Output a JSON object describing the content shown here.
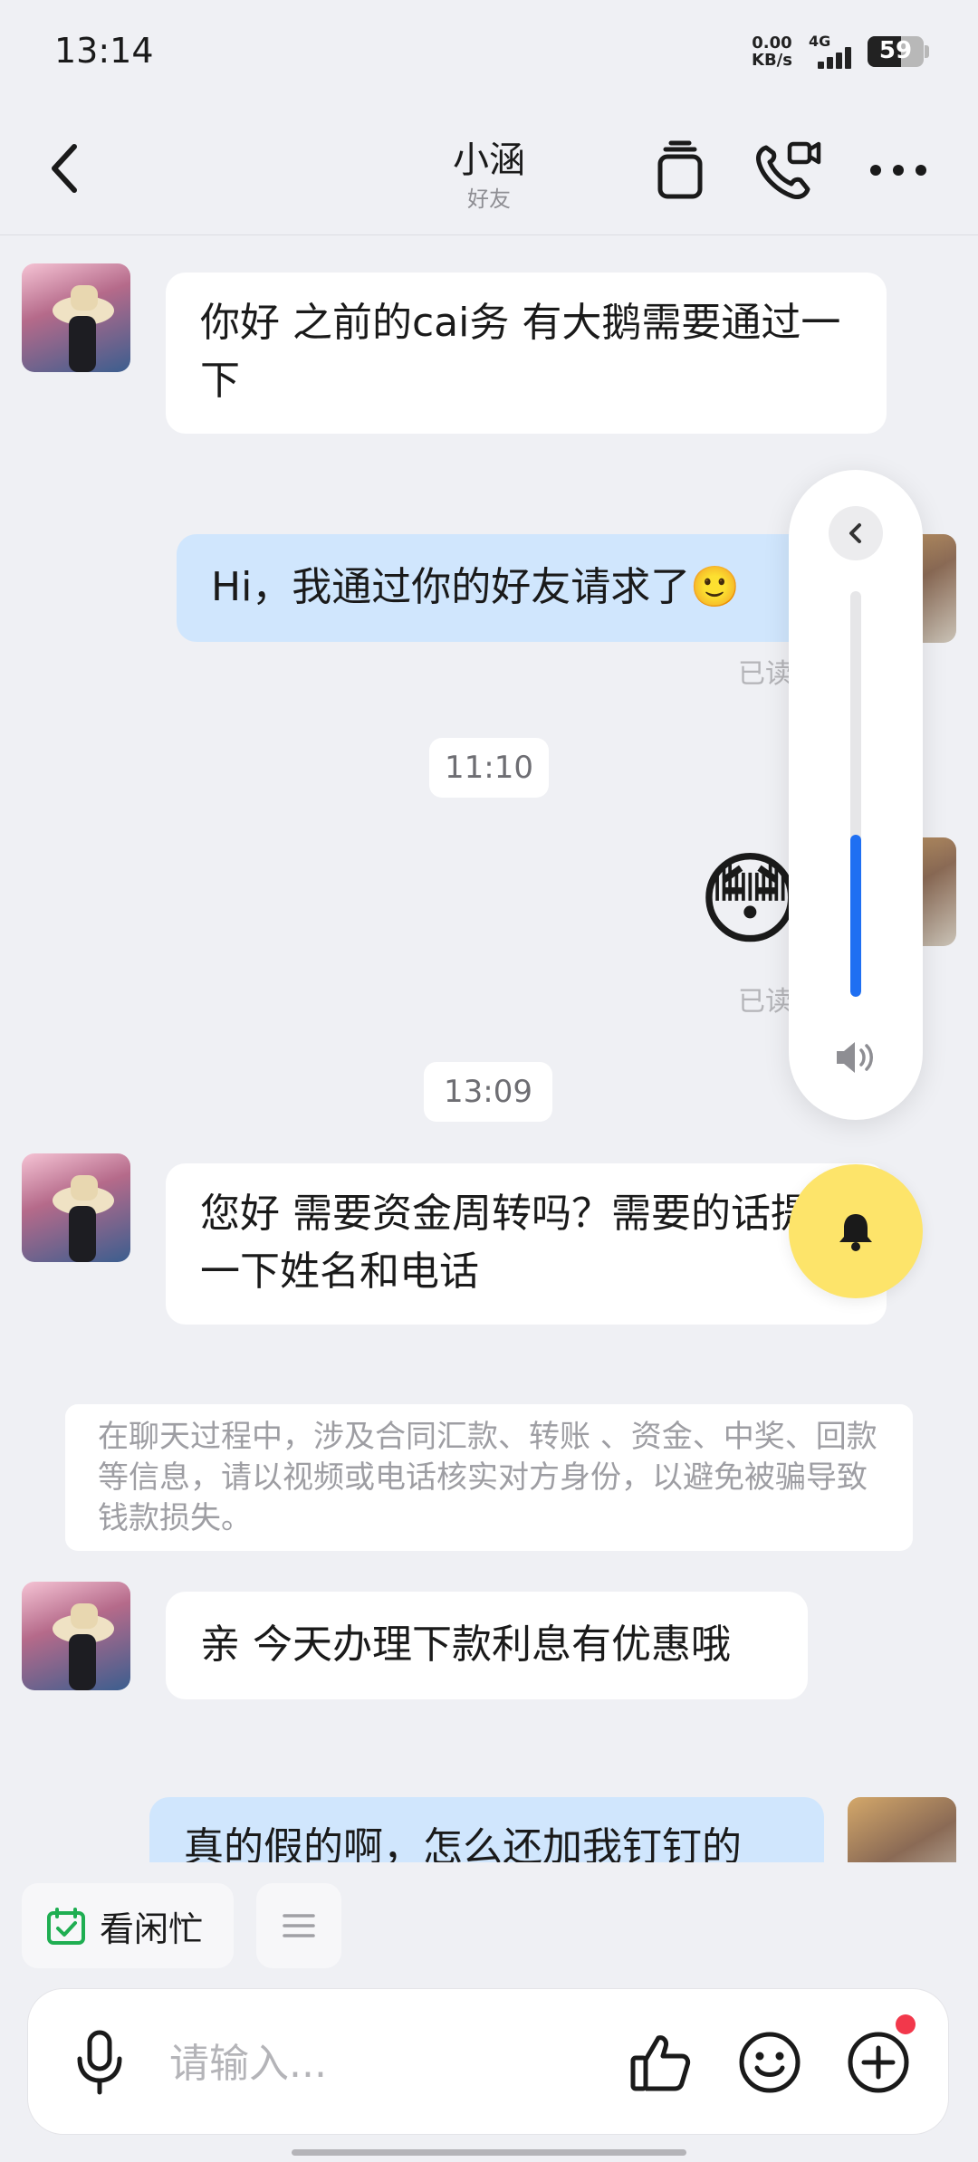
{
  "status_bar": {
    "time": "13:14",
    "net_speed_value": "0.00",
    "net_speed_unit": "KB/s",
    "network": "4G",
    "battery": "59",
    "battery_level": 0.59
  },
  "header": {
    "title": "小涵",
    "subtitle": "好友",
    "icons": [
      "back-icon",
      "copy-icon",
      "call-video-icon",
      "more-icon"
    ]
  },
  "messages": [
    {
      "side": "in",
      "text": "你好 之前的cai务 有大鹅需要通过一下"
    },
    {
      "side": "out",
      "text": "Hi，我通过你的好友请求了🙂",
      "status": "已读"
    },
    {
      "side": "time",
      "text": "11:10"
    },
    {
      "side": "out",
      "emoji": "😳",
      "status": "已读"
    },
    {
      "side": "time",
      "text": "13:09"
    },
    {
      "side": "in",
      "text": "您好 需要资金周转吗？需要的话提供一下姓名和电话"
    },
    {
      "side": "notice",
      "text": "在聊天过程中，涉及合同汇款、转账 、资金、中奖、回款等信息，请以视频或电话核实对方身份，以避免被骗导致钱款损失。"
    },
    {
      "side": "in",
      "text": "亲 今天办理下款利息有优惠哦"
    },
    {
      "side": "out",
      "text": "真的假的啊，怎么还加我钉钉的"
    }
  ],
  "volume_panel": {
    "level": 0.4,
    "icons": [
      "collapse-icon",
      "speaker-icon"
    ],
    "accent": "#1f6ff2"
  },
  "bell_button": {
    "icon": "bell-icon",
    "color": "#fde46a"
  },
  "quick_actions": [
    {
      "label": "看闲忙",
      "icon": "calendar-check-icon"
    },
    {
      "label": "",
      "icon": "menu-icon"
    }
  ],
  "input": {
    "placeholder": "请输入...",
    "value": "",
    "icons": [
      "mic-icon",
      "thumbs-up-icon",
      "smile-icon",
      "plus-icon"
    ],
    "badge_color": "#f2384b"
  }
}
